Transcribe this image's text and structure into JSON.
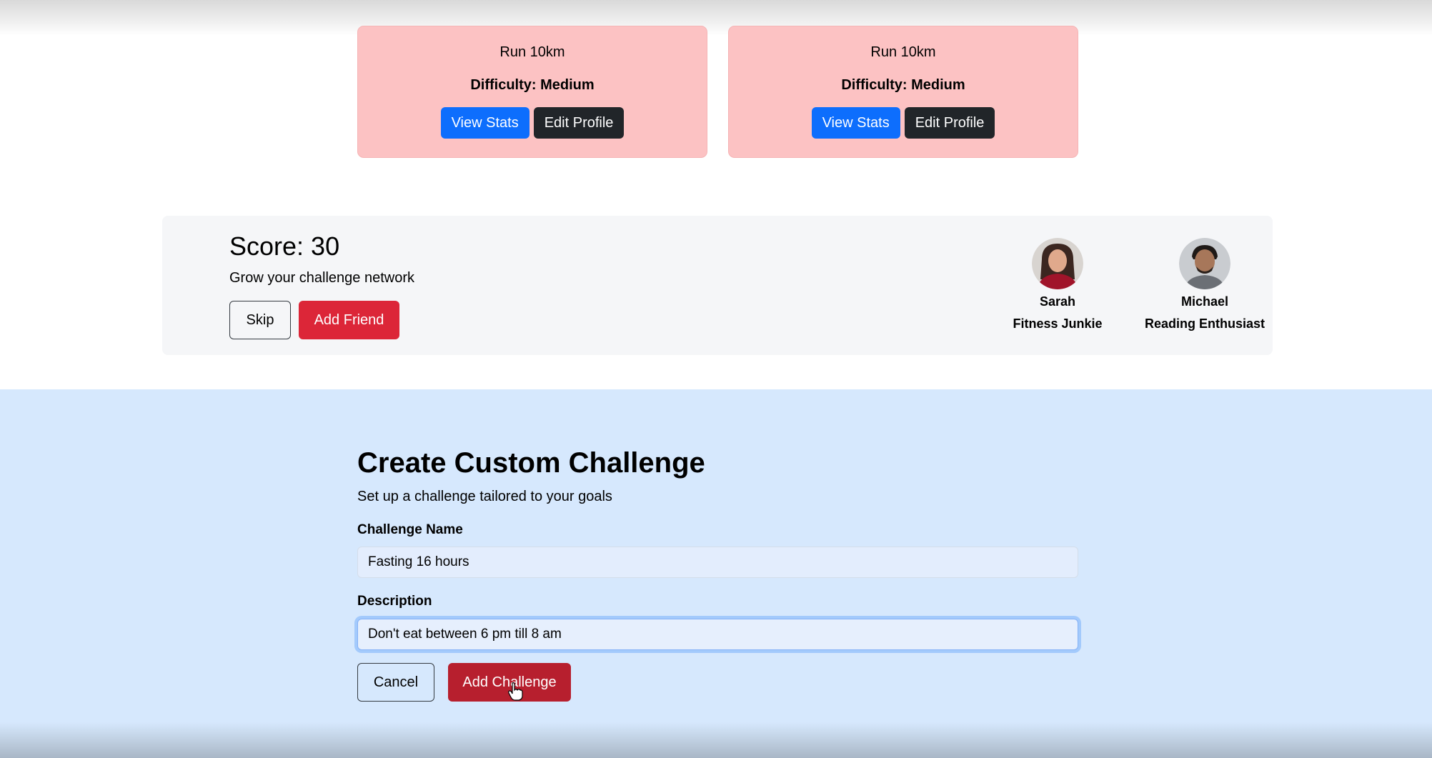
{
  "cards": [
    {
      "title": "Run 10km",
      "difficulty": "Difficulty: Medium",
      "view_stats_label": "View Stats",
      "edit_profile_label": "Edit Profile"
    },
    {
      "title": "Run 10km",
      "difficulty": "Difficulty: Medium",
      "view_stats_label": "View Stats",
      "edit_profile_label": "Edit Profile"
    }
  ],
  "score_panel": {
    "score": "Score: 30",
    "subtitle": "Grow your challenge network",
    "skip_label": "Skip",
    "add_friend_label": "Add Friend",
    "friends": [
      {
        "name": "Sarah",
        "role": "Fitness Junkie"
      },
      {
        "name": "Michael",
        "role": "Reading Enthusiast"
      }
    ]
  },
  "create_challenge": {
    "title": "Create Custom Challenge",
    "subtitle": "Set up a challenge tailored to your goals",
    "name_label": "Challenge Name",
    "name_value": "Fasting 16 hours",
    "description_label": "Description",
    "description_value": "Don't eat between 6 pm till 8 am",
    "cancel_label": "Cancel",
    "add_label": "Add Challenge"
  },
  "colors": {
    "card_bg": "#fcc2c3",
    "primary": "#0d6efd",
    "dark": "#212529",
    "danger": "#dc2638",
    "section_bg": "#d6e8fd"
  }
}
